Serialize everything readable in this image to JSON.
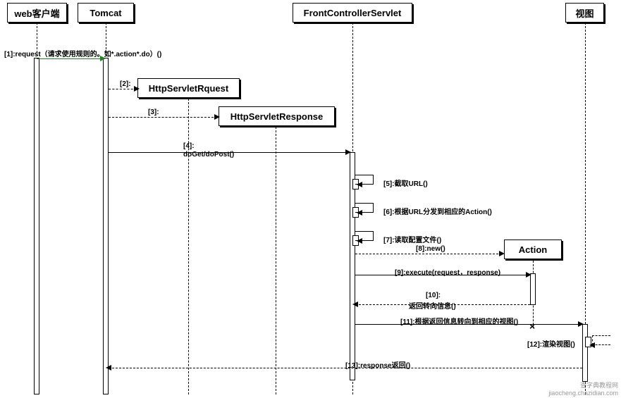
{
  "participants": {
    "p1": "web客户端",
    "p2": "Tomcat",
    "p3": "FrontControllerServlet",
    "p4": "视图",
    "p5": "HttpServletRquest",
    "p6": "HttpServletResponse",
    "p7": "Action"
  },
  "messages": {
    "m1": "[1]:request（请求使用规则的。如*.action*.do）()",
    "m2": "[2]:",
    "m3": "[3]:",
    "m4": "[4]:",
    "m4b": "doGet/doPost()",
    "m5": "[5]:截取URL()",
    "m6": "[6]:根据URL分发到相应的Action()",
    "m7": "[7]:读取配置文件()",
    "m8": "[8]:new()",
    "m9": "[9]:execute(request，response)",
    "m10": "[10]:",
    "m10b": "返回转向信息()",
    "m11": "[11]:根据返回信息转向到相应的视图()",
    "m12": "[12]:渲染视图()",
    "m13": "[13]:response返回()"
  },
  "watermark": "查字典教程网\njiaocheng.chazidian.com"
}
